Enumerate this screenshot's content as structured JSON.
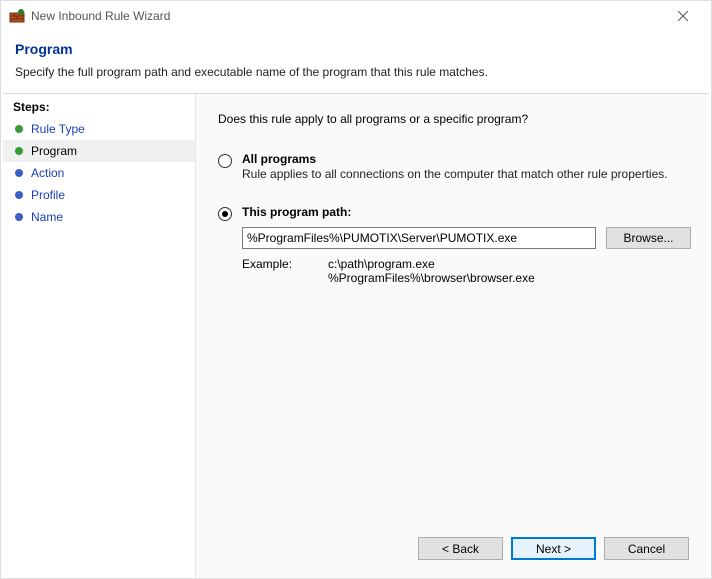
{
  "window": {
    "title": "New Inbound Rule Wizard"
  },
  "header": {
    "title": "Program",
    "subtitle": "Specify the full program path and executable name of the program that this rule matches."
  },
  "sidebar": {
    "title": "Steps:",
    "items": [
      {
        "label": "Rule Type",
        "state": "completed"
      },
      {
        "label": "Program",
        "state": "current"
      },
      {
        "label": "Action",
        "state": "future"
      },
      {
        "label": "Profile",
        "state": "future"
      },
      {
        "label": "Name",
        "state": "future"
      }
    ]
  },
  "content": {
    "question": "Does this rule apply to all programs or a specific program?",
    "option_all": {
      "title": "All programs",
      "desc": "Rule applies to all connections on the computer that match other rule properties.",
      "selected": false
    },
    "option_path": {
      "title": "This program path:",
      "selected": true,
      "value": "%ProgramFiles%\\PUMOTIX\\Server\\PUMOTIX.exe",
      "browse_label": "Browse..."
    },
    "example": {
      "label": "Example:",
      "paths": "c:\\path\\program.exe\n%ProgramFiles%\\browser\\browser.exe"
    }
  },
  "buttons": {
    "back": "< Back",
    "next": "Next >",
    "cancel": "Cancel"
  }
}
